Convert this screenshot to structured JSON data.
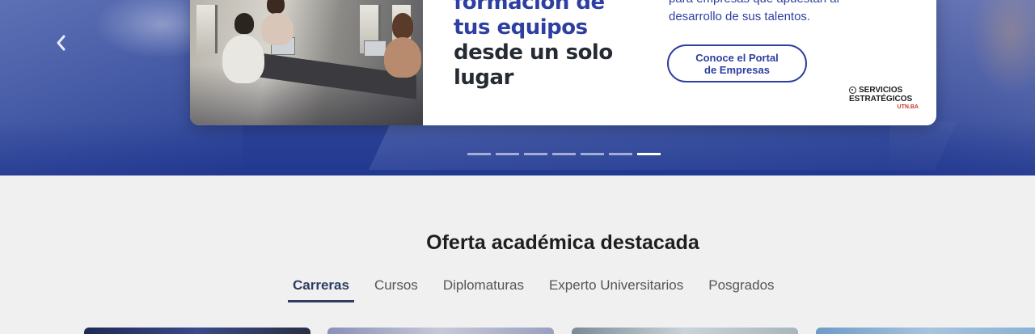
{
  "carousel": {
    "headline_line1": "formación de",
    "headline_line2": "tus equipos",
    "headline_line3": "desde un solo",
    "headline_line4": "lugar",
    "desc_line1": "para empresas que apuestan al",
    "desc_line2": "desarrollo de sus talentos.",
    "cta_label_line1": "Conoce el Portal",
    "cta_label_line2": "de Empresas",
    "brand_line1": "SERVICIOS",
    "brand_line2": "ESTRATÉGICOS",
    "brand_sub": "UTN.BA",
    "prev_icon": "chevron-left-icon",
    "slide_count": 7,
    "active_slide": 7
  },
  "section": {
    "title": "Oferta académica destacada"
  },
  "tabs": [
    {
      "label": "Carreras",
      "active": true
    },
    {
      "label": "Cursos",
      "active": false
    },
    {
      "label": "Diplomaturas",
      "active": false
    },
    {
      "label": "Experto Universitarios",
      "active": false
    },
    {
      "label": "Posgrados",
      "active": false
    }
  ],
  "colors": {
    "brand_blue": "#2d3fa0",
    "tab_active": "#2c3e63",
    "hero_bg": "#2f4597",
    "page_bg": "#f0f0f0"
  }
}
